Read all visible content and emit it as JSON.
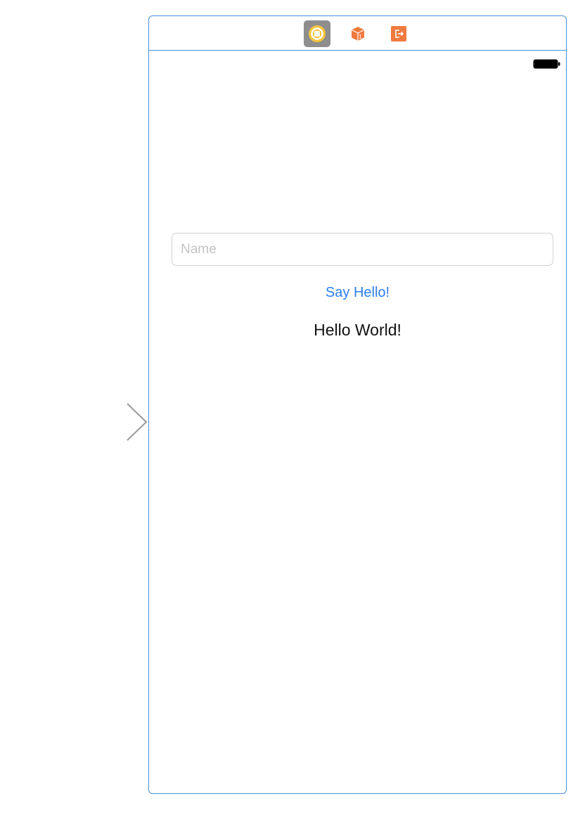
{
  "entry_point": {
    "icon": "entry-arrow-icon"
  },
  "scene": {
    "dock": {
      "icons": [
        {
          "name": "view-controller-icon",
          "color": "#f5c53a"
        },
        {
          "name": "first-responder-icon",
          "color": "#f07a3f"
        },
        {
          "name": "exit-icon",
          "color": "#f07a3f"
        }
      ]
    },
    "status_bar": {
      "battery_icon": "battery-icon"
    },
    "name_field": {
      "placeholder": "Name",
      "value": ""
    },
    "say_hello_button": {
      "label": "Say Hello!",
      "color": "#2d7ff0"
    },
    "greeting_label": {
      "text": "Hello World!"
    }
  },
  "colors": {
    "frame_border": "#4a8fd6",
    "background": "#ffffff"
  }
}
